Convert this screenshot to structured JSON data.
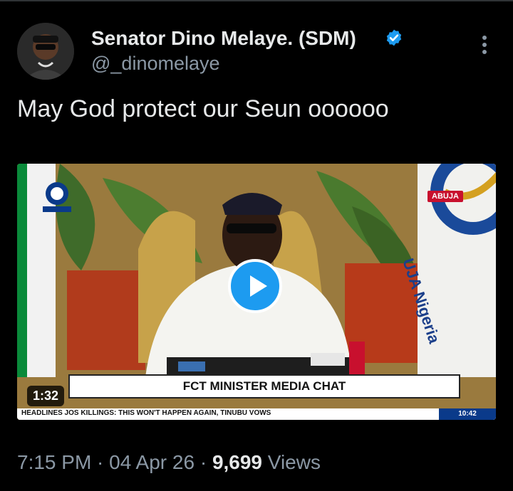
{
  "author": {
    "name": "Senator Dino Melaye. (SDM)",
    "handle": "@_dinomelaye",
    "verified_icon": "verified-badge-icon",
    "avatar_icon": "avatar-photo"
  },
  "more_icon": "more-options-icon",
  "tweet": {
    "text": "May God protect our Seun oooooo"
  },
  "video": {
    "duration": "1:32",
    "location_tag": "ABUJA",
    "channel_logo": "CHANNELS",
    "banner": "FCT MINISTER MEDIA CHAT",
    "ticker": "HEADLINES   JOS KILLINGS: THIS WON'T HAPPEN AGAIN, TINUBU VOWS",
    "ticker_time": "10:42",
    "backdrop_text": "UJA Nigeria",
    "play_icon": "play-icon"
  },
  "meta": {
    "time": "7:15 PM",
    "sep1": " · ",
    "date": "04 Apr 26",
    "sep2": " · ",
    "views_count": "9,699",
    "views_label": " Views"
  },
  "colors": {
    "accent": "#1d9bf0",
    "background": "#000000",
    "secondary_text": "#8b98a5"
  }
}
